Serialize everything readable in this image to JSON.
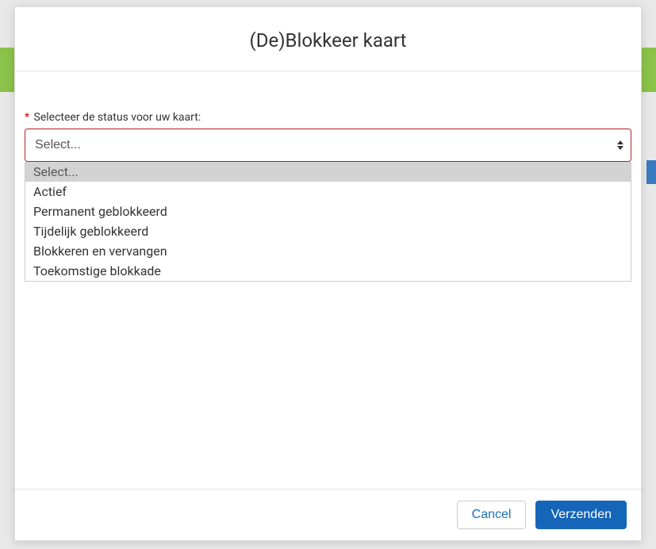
{
  "modal": {
    "title": "(De)Blokkeer kaart",
    "form": {
      "label": "Selecteer de status voor uw kaart:",
      "required_mark": "*",
      "placeholder": "Select...",
      "options": [
        "Select...",
        "Actief",
        "Permanent geblokkeerd",
        "Tijdelijk geblokkeerd",
        "Blokkeren en vervangen",
        "Toekomstige blokkade"
      ]
    },
    "footer": {
      "cancel_label": "Cancel",
      "submit_label": "Verzenden"
    }
  }
}
